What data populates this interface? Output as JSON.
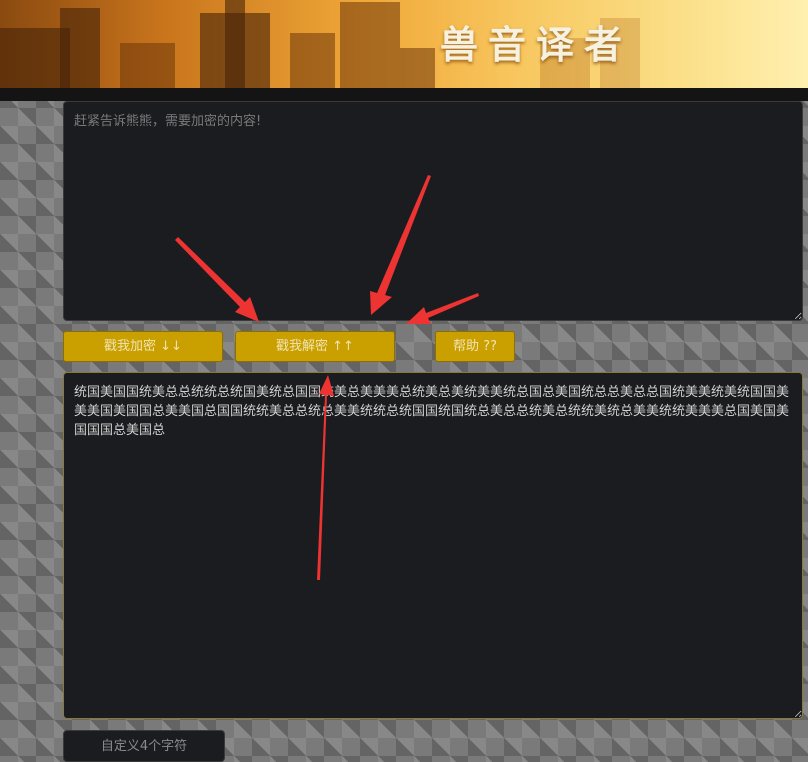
{
  "banner": {
    "title": "兽音译者"
  },
  "input": {
    "placeholder": "赶紧告诉熊熊，需要加密的内容!"
  },
  "buttons": {
    "encrypt": "戳我加密 ↓↓",
    "decrypt": "戳我解密 ↑↑",
    "help": "帮助 ??"
  },
  "output": {
    "value": "统国美国国统美总总统统总统国美统总国国统美总美美美总统美总美统美美统总国总美国统总总美总总国统美美统美统国国美美美国美国国总美美国总国国统统美总总统总美美统统总统国国统国统总美总总统美总统统美统总美美统统美美美总国美国美国国国总美国总"
  },
  "custom": {
    "placeholder": "自定义4个字符"
  },
  "colors": {
    "button_bg": "#c9a000",
    "textarea_bg": "#1b1c1f",
    "arrow": "#ee3333"
  }
}
